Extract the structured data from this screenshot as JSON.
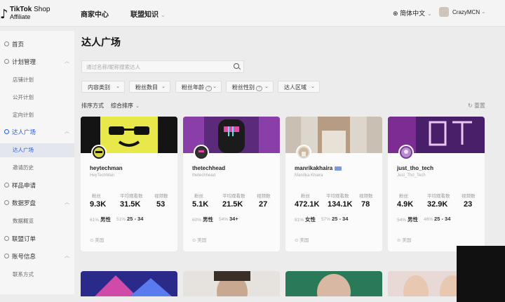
{
  "header": {
    "logo_line1_brand": "TikTok",
    "logo_line1_rest": " Shop",
    "logo_line2": "Affiliate",
    "nav": [
      "商家中心",
      "联盟知识"
    ],
    "language": "简体中文",
    "user_name": "CrazyMCN"
  },
  "sidebar": {
    "items": [
      {
        "label": "首页"
      },
      {
        "label": "计划管理",
        "children": [
          "店铺计划",
          "公开计划",
          "定向计划"
        ]
      },
      {
        "label": "达人广场",
        "children": [
          "达人广场",
          "邀请历史"
        ]
      },
      {
        "label": "样品申请"
      },
      {
        "label": "数据罗盘",
        "children": [
          "数据概览"
        ]
      },
      {
        "label": "联盟订单"
      },
      {
        "label": "账号信息",
        "children": [
          "联系方式"
        ]
      }
    ]
  },
  "main": {
    "title": "达人广场",
    "search_placeholder": "通过名称/昵称搜索达人",
    "filters": [
      "内容类别",
      "粉丝数目",
      "粉丝年龄",
      "粉丝性别",
      "达人区域"
    ],
    "sort_label": "排序方式",
    "sort_value": "综合排序",
    "reset": "重置"
  },
  "cards": [
    {
      "name": "heytechman",
      "handle": "HeyTechMan",
      "labels": [
        "粉丝",
        "平均观看数",
        "视频数"
      ],
      "values": [
        "9.3K",
        "31.5K",
        "53"
      ],
      "gender_pct": "61%",
      "gender": "男性",
      "age_pct": "51%",
      "age": "25 - 34",
      "region": "美国"
    },
    {
      "name": "thetechhead",
      "handle": "thetechhead",
      "labels": [
        "粉丝",
        "平均观看数",
        "视频数"
      ],
      "values": [
        "5.1K",
        "21.5K",
        "27"
      ],
      "gender_pct": "60%",
      "gender": "男性",
      "age_pct": "54%",
      "age": "34+",
      "region": "美国"
    },
    {
      "name": "manrikakhaira",
      "handle": "Manrika Khaira",
      "labels": [
        "粉丝",
        "平均观看数",
        "视频数"
      ],
      "values": [
        "472.1K",
        "134.1K",
        "78"
      ],
      "gender_pct": "81%",
      "gender": "女性",
      "age_pct": "57%",
      "age": "25 - 34",
      "region": "美国"
    },
    {
      "name": "just_tho_tech",
      "handle": "Just_Tho_Tech",
      "labels": [
        "粉丝",
        "平均观看数",
        "视频数"
      ],
      "values": [
        "4.9K",
        "32.9K",
        "23"
      ],
      "gender_pct": "54%",
      "gender": "男性",
      "age_pct": "46%",
      "age": "25 - 34",
      "region": "美国"
    }
  ],
  "colors": {
    "accent": "#2a5cd6",
    "cover1": "#111111",
    "cover2": "#5b2a7a",
    "cover3": "#d8d0c4",
    "cover4": "#6b2a8c"
  }
}
